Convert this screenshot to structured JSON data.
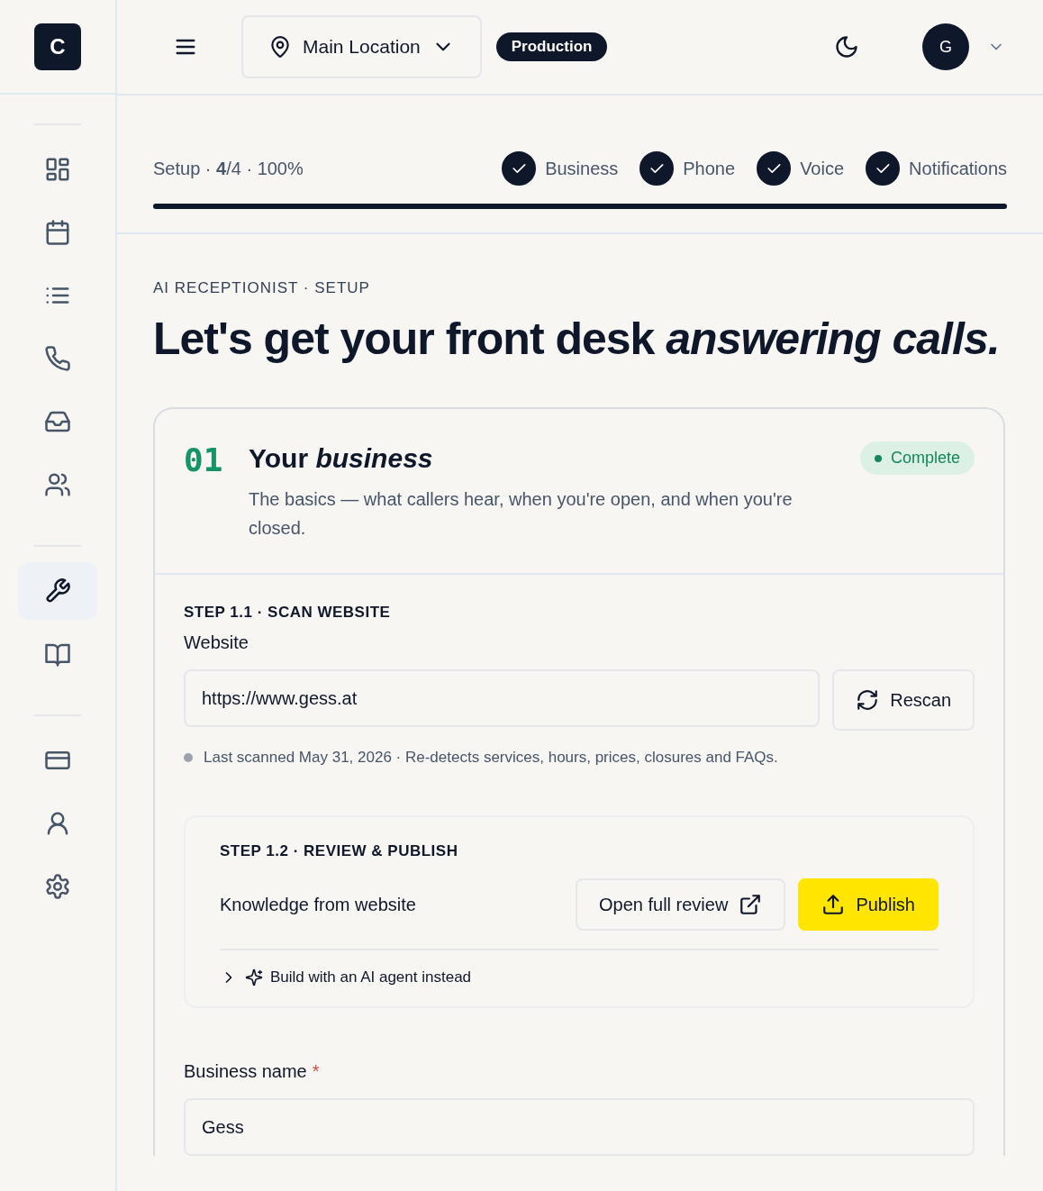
{
  "sidebar": {
    "logo": "C",
    "groups": [
      [
        {
          "kind": "dashboard",
          "selected": false
        },
        {
          "kind": "calendar",
          "selected": false
        },
        {
          "kind": "list",
          "selected": false
        },
        {
          "kind": "phone",
          "selected": false
        },
        {
          "kind": "inbox",
          "selected": false
        },
        {
          "kind": "users",
          "selected": false
        }
      ],
      [
        {
          "kind": "wrench",
          "selected": true
        },
        {
          "kind": "book",
          "selected": false
        }
      ],
      [
        {
          "kind": "card",
          "selected": false
        },
        {
          "kind": "user",
          "selected": false
        },
        {
          "kind": "gear",
          "selected": false
        }
      ]
    ]
  },
  "topbar": {
    "location": "Main Location",
    "environment": "Production",
    "avatar": "G"
  },
  "progress": {
    "summary": "Setup · **4**/4 · 100%",
    "level": 1,
    "steps": [
      {
        "label": "Business",
        "done": true
      },
      {
        "label": "Phone",
        "done": true
      },
      {
        "label": "Voice",
        "done": true
      },
      {
        "label": "Notifications",
        "done": true
      }
    ]
  },
  "eyebrow": "AI RECEPTIONIST · SETUP",
  "headline": "Let's get your front desk *answering calls.*",
  "section": {
    "number": "01",
    "title": "Your *business*",
    "description": "The basics — what callers hear, when you're open, and when you're closed.",
    "status": "Complete",
    "scan": {
      "step": "STEP 1.1 · SCAN WEBSITE",
      "label": "Website",
      "value": "https://www.gess.at",
      "button": "Rescan",
      "note": "Last scanned May 31, 2026 · Re-detects services, hours, prices, closures and FAQs."
    },
    "review": {
      "step": "STEP 1.2 · REVIEW & PUBLISH",
      "label": "Knowledge from website",
      "secondary": "Open full review",
      "primary": "Publish",
      "expander": "Build with an AI agent instead",
      "expanded": false
    },
    "name_field": {
      "label": "Business name",
      "required_mark": "*",
      "value": "Gess"
    }
  }
}
